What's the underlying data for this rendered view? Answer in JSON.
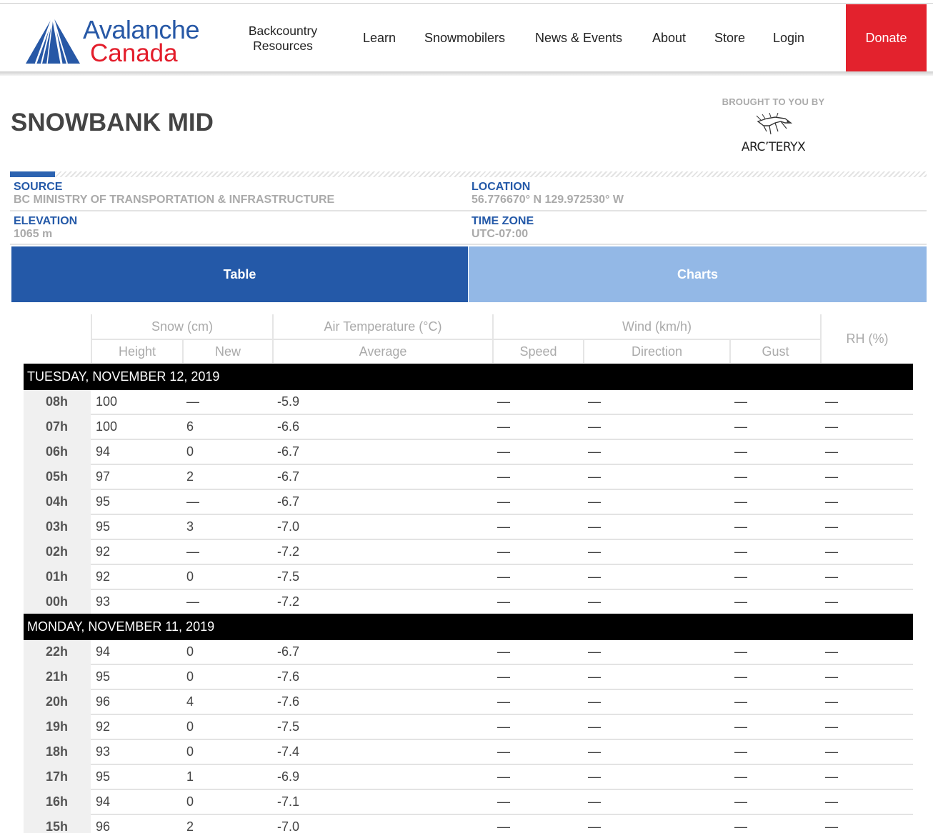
{
  "header": {
    "logo_line1": "Avalanche",
    "logo_line2": "Canada",
    "nav": {
      "backcountry_line1": "Backcountry",
      "backcountry_line2": "Resources",
      "learn": "Learn",
      "snowmobilers": "Snowmobilers",
      "news_events": "News & Events",
      "about": "About",
      "store": "Store",
      "login": "Login"
    },
    "donate": "Donate"
  },
  "page": {
    "title": "SNOWBANK MID",
    "sponsor_label": "BROUGHT TO YOU BY",
    "sponsor_name": "ARC’TERYX"
  },
  "meta": {
    "source_label": "SOURCE",
    "source_value": "BC MINISTRY OF TRANSPORTATION & INFRASTRUCTURE",
    "location_label": "LOCATION",
    "location_value": "56.776670° N 129.972530° W",
    "elevation_label": "ELEVATION",
    "elevation_value": "1065 m",
    "timezone_label": "TIME ZONE",
    "timezone_value": "UTC-07:00"
  },
  "tabs": {
    "table": "Table",
    "charts": "Charts"
  },
  "colors": {
    "brand_blue": "#2459a8",
    "brand_red": "#e3222d",
    "tab_inactive": "#93b8e6"
  },
  "table": {
    "groups": {
      "snow": "Snow (cm)",
      "air": "Air Temperature (°C)",
      "wind": "Wind (km/h)",
      "rh": "RH (%)"
    },
    "columns": {
      "height": "Height",
      "new": "New",
      "average": "Average",
      "speed": "Speed",
      "direction": "Direction",
      "gust": "Gust"
    },
    "days": [
      {
        "label": "TUESDAY, NOVEMBER 12, 2019",
        "rows": [
          {
            "hour": "08h",
            "height": "100",
            "new": "—",
            "avg": "-5.9",
            "speed": "—",
            "direction": "—",
            "gust": "—",
            "rh": "—"
          },
          {
            "hour": "07h",
            "height": "100",
            "new": "6",
            "avg": "-6.6",
            "speed": "—",
            "direction": "—",
            "gust": "—",
            "rh": "—"
          },
          {
            "hour": "06h",
            "height": "94",
            "new": "0",
            "avg": "-6.7",
            "speed": "—",
            "direction": "—",
            "gust": "—",
            "rh": "—"
          },
          {
            "hour": "05h",
            "height": "97",
            "new": "2",
            "avg": "-6.7",
            "speed": "—",
            "direction": "—",
            "gust": "—",
            "rh": "—"
          },
          {
            "hour": "04h",
            "height": "95",
            "new": "—",
            "avg": "-6.7",
            "speed": "—",
            "direction": "—",
            "gust": "—",
            "rh": "—"
          },
          {
            "hour": "03h",
            "height": "95",
            "new": "3",
            "avg": "-7.0",
            "speed": "—",
            "direction": "—",
            "gust": "—",
            "rh": "—"
          },
          {
            "hour": "02h",
            "height": "92",
            "new": "—",
            "avg": "-7.2",
            "speed": "—",
            "direction": "—",
            "gust": "—",
            "rh": "—"
          },
          {
            "hour": "01h",
            "height": "92",
            "new": "0",
            "avg": "-7.5",
            "speed": "—",
            "direction": "—",
            "gust": "—",
            "rh": "—"
          },
          {
            "hour": "00h",
            "height": "93",
            "new": "—",
            "avg": "-7.2",
            "speed": "—",
            "direction": "—",
            "gust": "—",
            "rh": "—"
          }
        ]
      },
      {
        "label": "MONDAY, NOVEMBER 11, 2019",
        "rows": [
          {
            "hour": "22h",
            "height": "94",
            "new": "0",
            "avg": "-6.7",
            "speed": "—",
            "direction": "—",
            "gust": "—",
            "rh": "—"
          },
          {
            "hour": "21h",
            "height": "95",
            "new": "0",
            "avg": "-7.6",
            "speed": "—",
            "direction": "—",
            "gust": "—",
            "rh": "—"
          },
          {
            "hour": "20h",
            "height": "96",
            "new": "4",
            "avg": "-7.6",
            "speed": "—",
            "direction": "—",
            "gust": "—",
            "rh": "—"
          },
          {
            "hour": "19h",
            "height": "92",
            "new": "0",
            "avg": "-7.5",
            "speed": "—",
            "direction": "—",
            "gust": "—",
            "rh": "—"
          },
          {
            "hour": "18h",
            "height": "93",
            "new": "0",
            "avg": "-7.4",
            "speed": "—",
            "direction": "—",
            "gust": "—",
            "rh": "—"
          },
          {
            "hour": "17h",
            "height": "95",
            "new": "1",
            "avg": "-6.9",
            "speed": "—",
            "direction": "—",
            "gust": "—",
            "rh": "—"
          },
          {
            "hour": "16h",
            "height": "94",
            "new": "0",
            "avg": "-7.1",
            "speed": "—",
            "direction": "—",
            "gust": "—",
            "rh": "—"
          },
          {
            "hour": "15h",
            "height": "96",
            "new": "2",
            "avg": "-7.0",
            "speed": "—",
            "direction": "—",
            "gust": "—",
            "rh": "—"
          }
        ]
      }
    ]
  }
}
